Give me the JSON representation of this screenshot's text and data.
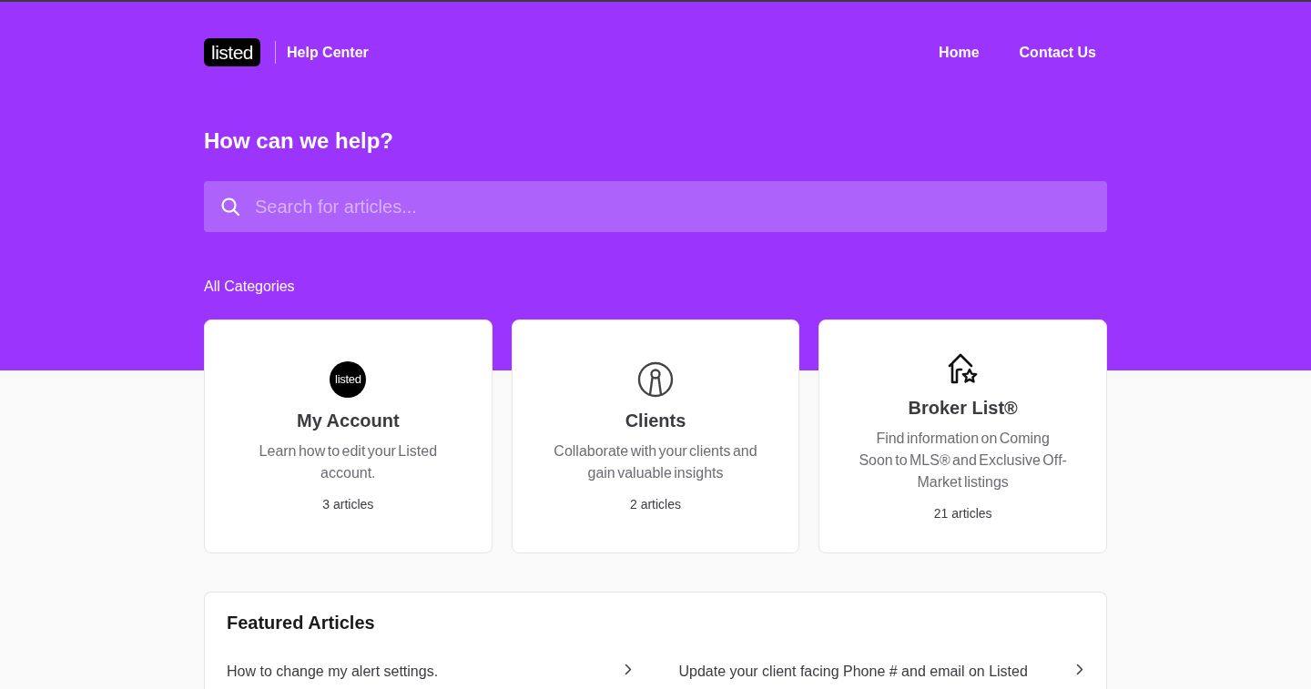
{
  "header": {
    "logo": "listed",
    "site_title": "Help Center",
    "nav": [
      "Home",
      "Contact Us"
    ]
  },
  "hero": {
    "heading": "How can we help?",
    "search": {
      "placeholder": "Search for articles..."
    }
  },
  "categories": {
    "heading": "All Categories",
    "items": [
      {
        "kind": "logo",
        "icon_text": "listed",
        "title": "My Account",
        "description": "Learn how to edit your Listed account.",
        "count": "3 articles"
      },
      {
        "kind": "person",
        "title": "Clients",
        "description": "Collaborate with your clients and gain valuable insights",
        "count": "2 articles"
      },
      {
        "kind": "house-star",
        "title": "Broker List®",
        "description": "Find information on Coming Soon to MLS® and Exclusive Off-Market listings",
        "count": "21 articles"
      }
    ]
  },
  "featured": {
    "heading": "Featured Articles",
    "articles": [
      "How to change my alert settings.",
      "Update your client facing Phone # and email on Listed"
    ]
  }
}
